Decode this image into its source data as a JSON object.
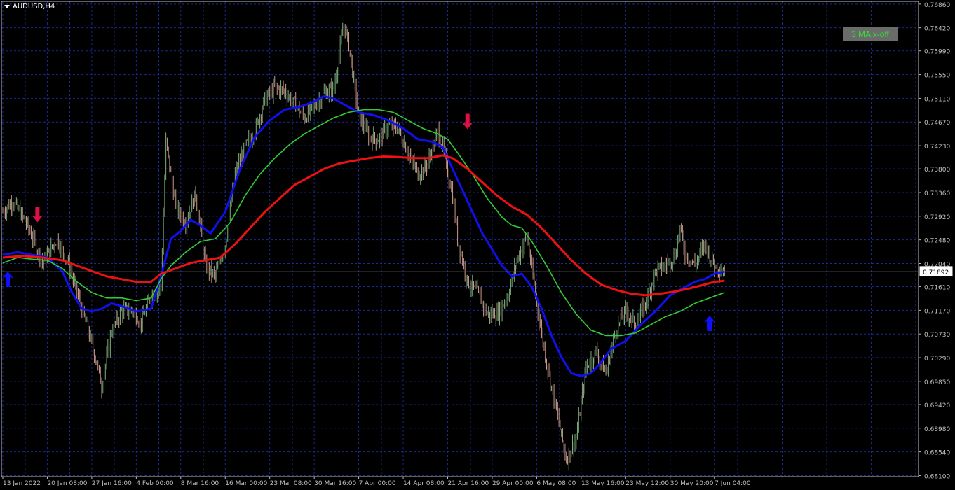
{
  "symbol_label": "AUDUSD,H4",
  "indicator_badge": "3 MA x-off",
  "colors": {
    "background": "#000000",
    "grid": "#1c2a8a",
    "axis": "#c0c0c0",
    "bull_bar": "#7bb07b",
    "bear_bar": "#c9998a",
    "ma_fast": "#1010ee",
    "ma_mid": "#33cc33",
    "ma_slow": "#ee1111",
    "arrow_up": "#1010ff",
    "arrow_down": "#dd1144",
    "badge_bg": "#6b6b6b",
    "badge_text": "#2ee82e"
  },
  "chart_data": {
    "type": "line",
    "symbol": "AUDUSD",
    "timeframe": "H4",
    "ylim": [
      0.6808,
      0.7691
    ],
    "y_ticks": [
      "0.76860",
      "0.76420",
      "0.75990",
      "0.75550",
      "0.75110",
      "0.74670",
      "0.74230",
      "0.73800",
      "0.73360",
      "0.72920",
      "0.72480",
      "0.72040",
      "0.71610",
      "0.71170",
      "0.70730",
      "0.70290",
      "0.69850",
      "0.69420",
      "0.68980",
      "0.68540",
      "0.68100"
    ],
    "current_price": "0.71892",
    "x_ticks": [
      "13 Jan 2022",
      "20 Jan 08:00",
      "27 Jan 16:00",
      "4 Feb 00:00",
      "8 Mar 16:00",
      "16 Mar 00:00",
      "23 Mar 08:00",
      "30 Mar 16:00",
      "7 Apr 00:00",
      "14 Apr 08:00",
      "21 Apr 16:00",
      "29 Apr 00:00",
      "6 May 08:00",
      "13 May 16:00",
      "23 May 12:00",
      "30 May 20:00",
      "7 Jun 04:00"
    ],
    "x_tick_index": [
      0,
      9,
      18,
      27,
      36,
      45,
      54,
      63,
      72,
      81,
      90,
      99,
      108,
      117,
      126,
      135,
      144
    ],
    "price_path": [
      [
        0,
        0.73
      ],
      [
        2,
        0.732
      ],
      [
        5,
        0.7275
      ],
      [
        8,
        0.7205
      ],
      [
        11,
        0.725
      ],
      [
        13,
        0.721
      ],
      [
        16,
        0.712
      ],
      [
        19,
        0.702
      ],
      [
        20,
        0.6975
      ],
      [
        22,
        0.708
      ],
      [
        24,
        0.7115
      ],
      [
        26,
        0.712
      ],
      [
        28,
        0.7095
      ],
      [
        30,
        0.7145
      ],
      [
        32,
        0.716
      ],
      [
        33,
        0.743
      ],
      [
        35,
        0.731
      ],
      [
        37,
        0.728
      ],
      [
        39,
        0.7335
      ],
      [
        41,
        0.72
      ],
      [
        43,
        0.718
      ],
      [
        45,
        0.724
      ],
      [
        47,
        0.737
      ],
      [
        49,
        0.742
      ],
      [
        51,
        0.745
      ],
      [
        53,
        0.751
      ],
      [
        55,
        0.753
      ],
      [
        57,
        0.7525
      ],
      [
        59,
        0.75
      ],
      [
        61,
        0.7475
      ],
      [
        63,
        0.7495
      ],
      [
        65,
        0.752
      ],
      [
        67,
        0.753
      ],
      [
        69,
        0.765
      ],
      [
        70,
        0.761
      ],
      [
        72,
        0.748
      ],
      [
        74,
        0.744
      ],
      [
        76,
        0.7435
      ],
      [
        78,
        0.746
      ],
      [
        80,
        0.7455
      ],
      [
        82,
        0.741
      ],
      [
        84,
        0.737
      ],
      [
        86,
        0.739
      ],
      [
        88,
        0.745
      ],
      [
        89,
        0.742
      ],
      [
        91,
        0.733
      ],
      [
        92,
        0.725
      ],
      [
        94,
        0.717
      ],
      [
        96,
        0.715
      ],
      [
        98,
        0.711
      ],
      [
        100,
        0.711
      ],
      [
        102,
        0.714
      ],
      [
        104,
        0.721
      ],
      [
        106,
        0.7255
      ],
      [
        108,
        0.713
      ],
      [
        110,
        0.702
      ],
      [
        112,
        0.693
      ],
      [
        114,
        0.684
      ],
      [
        116,
        0.688
      ],
      [
        118,
        0.701
      ],
      [
        120,
        0.704
      ],
      [
        122,
        0.7
      ],
      [
        124,
        0.708
      ],
      [
        126,
        0.7115
      ],
      [
        128,
        0.709
      ],
      [
        130,
        0.713
      ],
      [
        132,
        0.719
      ],
      [
        134,
        0.72
      ],
      [
        136,
        0.722
      ],
      [
        137,
        0.727
      ],
      [
        138,
        0.7225
      ],
      [
        140,
        0.72
      ],
      [
        142,
        0.724
      ],
      [
        144,
        0.72
      ],
      [
        146,
        0.7189
      ]
    ],
    "series": [
      {
        "name": "",
        "values": [
          [
            0,
            0.722
          ],
          [
            3,
            0.7225
          ],
          [
            6,
            0.722
          ],
          [
            9,
            0.7215
          ],
          [
            12,
            0.719
          ],
          [
            14,
            0.715
          ],
          [
            16,
            0.712
          ],
          [
            18,
            0.7115
          ],
          [
            20,
            0.712
          ],
          [
            22,
            0.713
          ],
          [
            24,
            0.7125
          ],
          [
            27,
            0.7115
          ],
          [
            30,
            0.712
          ],
          [
            32,
            0.718
          ],
          [
            34,
            0.725
          ],
          [
            36,
            0.7265
          ],
          [
            38,
            0.7285
          ],
          [
            40,
            0.7275
          ],
          [
            42,
            0.726
          ],
          [
            45,
            0.73
          ],
          [
            48,
            0.738
          ],
          [
            51,
            0.744
          ],
          [
            54,
            0.747
          ],
          [
            57,
            0.749
          ],
          [
            60,
            0.7495
          ],
          [
            63,
            0.7505
          ],
          [
            65,
            0.7515
          ],
          [
            67,
            0.751
          ],
          [
            69,
            0.75
          ],
          [
            72,
            0.7485
          ],
          [
            75,
            0.748
          ],
          [
            78,
            0.747
          ],
          [
            81,
            0.7455
          ],
          [
            84,
            0.7435
          ],
          [
            87,
            0.743
          ],
          [
            89,
            0.742
          ],
          [
            91,
            0.738
          ],
          [
            93,
            0.734
          ],
          [
            95,
            0.73
          ],
          [
            97,
            0.726
          ],
          [
            99,
            0.723
          ],
          [
            101,
            0.72
          ],
          [
            103,
            0.718
          ],
          [
            105,
            0.7185
          ],
          [
            107,
            0.716
          ],
          [
            109,
            0.712
          ],
          [
            111,
            0.707
          ],
          [
            113,
            0.703
          ],
          [
            115,
            0.7
          ],
          [
            117,
            0.6995
          ],
          [
            119,
            0.7
          ],
          [
            121,
            0.702
          ],
          [
            123,
            0.7045
          ],
          [
            126,
            0.706
          ],
          [
            129,
            0.709
          ],
          [
            132,
            0.7115
          ],
          [
            135,
            0.7145
          ],
          [
            138,
            0.716
          ],
          [
            140,
            0.717
          ],
          [
            142,
            0.7175
          ],
          [
            144,
            0.7185
          ],
          [
            146,
            0.7189
          ]
        ]
      },
      {
        "name": "",
        "values": [
          [
            0,
            0.7205
          ],
          [
            3,
            0.7215
          ],
          [
            6,
            0.7212
          ],
          [
            9,
            0.721
          ],
          [
            12,
            0.7195
          ],
          [
            15,
            0.717
          ],
          [
            18,
            0.715
          ],
          [
            21,
            0.714
          ],
          [
            24,
            0.714
          ],
          [
            27,
            0.7135
          ],
          [
            30,
            0.714
          ],
          [
            32,
            0.7175
          ],
          [
            34,
            0.72
          ],
          [
            37,
            0.7225
          ],
          [
            40,
            0.7245
          ],
          [
            43,
            0.725
          ],
          [
            46,
            0.728
          ],
          [
            49,
            0.733
          ],
          [
            52,
            0.737
          ],
          [
            55,
            0.74
          ],
          [
            58,
            0.7425
          ],
          [
            61,
            0.7445
          ],
          [
            64,
            0.746
          ],
          [
            67,
            0.7475
          ],
          [
            70,
            0.7485
          ],
          [
            73,
            0.749
          ],
          [
            76,
            0.749
          ],
          [
            79,
            0.7485
          ],
          [
            82,
            0.747
          ],
          [
            85,
            0.7455
          ],
          [
            88,
            0.7445
          ],
          [
            90,
            0.7435
          ],
          [
            92,
            0.741
          ],
          [
            95,
            0.737
          ],
          [
            98,
            0.7325
          ],
          [
            101,
            0.729
          ],
          [
            103,
            0.7275
          ],
          [
            105,
            0.727
          ],
          [
            107,
            0.7245
          ],
          [
            110,
            0.72
          ],
          [
            113,
            0.715
          ],
          [
            116,
            0.711
          ],
          [
            119,
            0.708
          ],
          [
            122,
            0.707
          ],
          [
            125,
            0.707
          ],
          [
            128,
            0.7075
          ],
          [
            131,
            0.709
          ],
          [
            134,
            0.7105
          ],
          [
            137,
            0.7115
          ],
          [
            140,
            0.713
          ],
          [
            143,
            0.714
          ],
          [
            146,
            0.715
          ]
        ]
      },
      {
        "name": "",
        "values": [
          [
            0,
            0.7215
          ],
          [
            4,
            0.7218
          ],
          [
            8,
            0.7215
          ],
          [
            12,
            0.721
          ],
          [
            15,
            0.72
          ],
          [
            18,
            0.719
          ],
          [
            21,
            0.718
          ],
          [
            24,
            0.7175
          ],
          [
            27,
            0.717
          ],
          [
            30,
            0.717
          ],
          [
            32,
            0.7185
          ],
          [
            35,
            0.7195
          ],
          [
            38,
            0.7205
          ],
          [
            41,
            0.721
          ],
          [
            44,
            0.7215
          ],
          [
            47,
            0.724
          ],
          [
            50,
            0.727
          ],
          [
            53,
            0.73
          ],
          [
            56,
            0.7325
          ],
          [
            59,
            0.735
          ],
          [
            62,
            0.7365
          ],
          [
            65,
            0.738
          ],
          [
            68,
            0.739
          ],
          [
            71,
            0.7395
          ],
          [
            74,
            0.74
          ],
          [
            77,
            0.7403
          ],
          [
            80,
            0.7402
          ],
          [
            83,
            0.74
          ],
          [
            86,
            0.74
          ],
          [
            89,
            0.7405
          ],
          [
            91,
            0.74
          ],
          [
            94,
            0.738
          ],
          [
            97,
            0.7355
          ],
          [
            100,
            0.733
          ],
          [
            103,
            0.731
          ],
          [
            106,
            0.7295
          ],
          [
            109,
            0.727
          ],
          [
            112,
            0.724
          ],
          [
            115,
            0.721
          ],
          [
            118,
            0.7185
          ],
          [
            121,
            0.7165
          ],
          [
            124,
            0.7155
          ],
          [
            127,
            0.7148
          ],
          [
            130,
            0.7145
          ],
          [
            133,
            0.7148
          ],
          [
            136,
            0.7152
          ],
          [
            139,
            0.7158
          ],
          [
            142,
            0.7165
          ],
          [
            144,
            0.717
          ],
          [
            146,
            0.7172
          ]
        ]
      }
    ],
    "signals": [
      {
        "type": "up",
        "bar": 1,
        "price": 0.7175
      },
      {
        "type": "down",
        "bar": 7,
        "price": 0.7295
      },
      {
        "type": "down",
        "bar": 94,
        "price": 0.7468
      },
      {
        "type": "up",
        "bar": 143,
        "price": 0.7093
      }
    ]
  }
}
